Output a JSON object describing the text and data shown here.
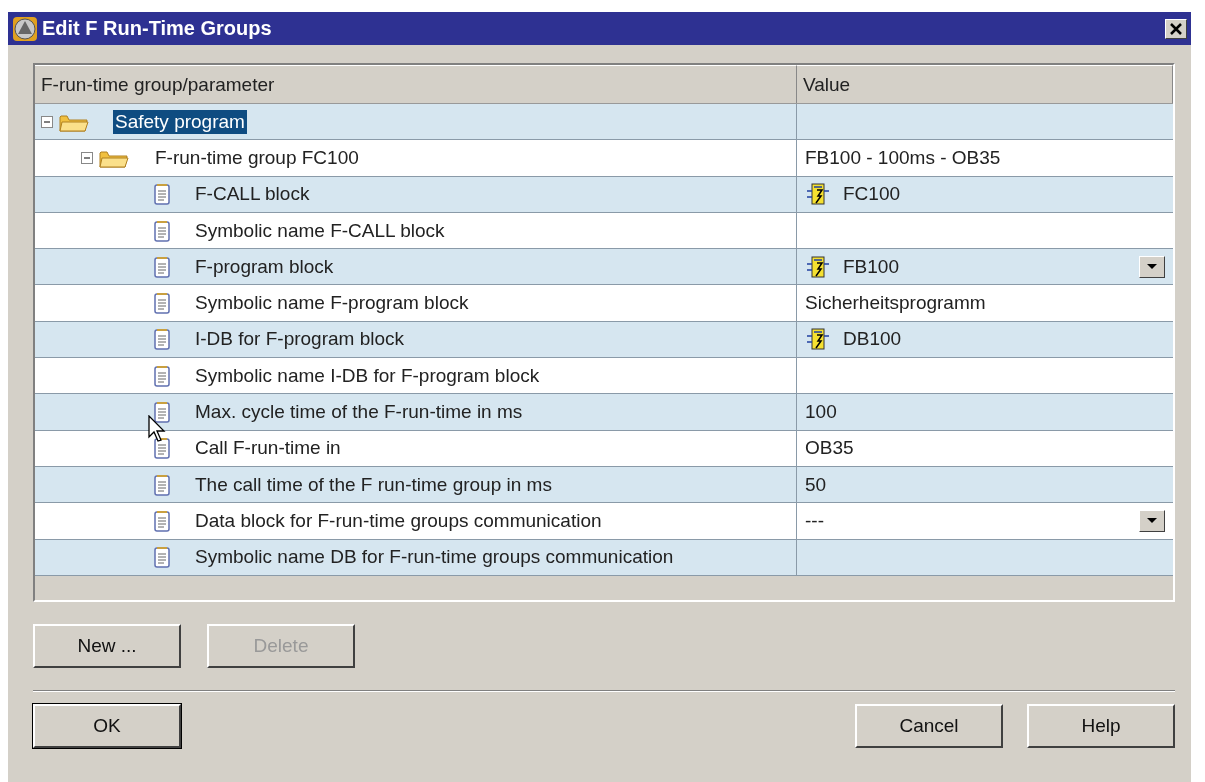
{
  "window": {
    "title": "Edit F Run-Time Groups"
  },
  "table": {
    "columns": [
      "F-run-time group/parameter",
      "Value"
    ],
    "tree": [
      {
        "label": "Safety program",
        "selected": true,
        "expanded": true,
        "children": [
          {
            "label": "F-run-time group FC100",
            "value": "FB100 - 100ms - OB35",
            "selected": false,
            "expanded": true,
            "children": [
              {
                "label": "F-CALL block",
                "value": "FC100",
                "kind": "block",
                "dropdown": false
              },
              {
                "label": "Symbolic name F-CALL block",
                "kind": "text",
                "dropdown": false
              },
              {
                "label": "F-program block",
                "value": "FB100",
                "kind": "block",
                "dropdown": true
              },
              {
                "label": "Symbolic name F-program block",
                "value": "Sicherheitsprogramm",
                "kind": "text",
                "dropdown": false
              },
              {
                "label": "I-DB for F-program block",
                "value": "DB100",
                "kind": "block",
                "dropdown": false
              },
              {
                "label": "Symbolic name I-DB for F-program block",
                "kind": "text",
                "dropdown": false
              },
              {
                "label": "Max. cycle time of the F-run-time in ms",
                "value": "100",
                "kind": "text",
                "dropdown": false
              },
              {
                "label": "Call F-run-time in",
                "value": "OB35",
                "kind": "text",
                "dropdown": false
              },
              {
                "label": "The call time of the F run-time group in ms",
                "value": "50",
                "kind": "text",
                "dropdown": false
              },
              {
                "label": "Data block for F-run-time groups communication",
                "value": "---",
                "kind": "text",
                "dropdown": true
              },
              {
                "label": "Symbolic name DB for F-run-time groups communication",
                "kind": "text",
                "dropdown": false
              }
            ]
          }
        ]
      }
    ]
  },
  "buttons": [
    {
      "label": "New ...",
      "disabled": false
    },
    {
      "label": "Delete",
      "disabled": true
    }
  ],
  "footer_buttons": [
    {
      "label": "OK",
      "default": true
    },
    {
      "label": "Cancel",
      "default": false
    },
    {
      "label": "Help",
      "default": false
    }
  ]
}
